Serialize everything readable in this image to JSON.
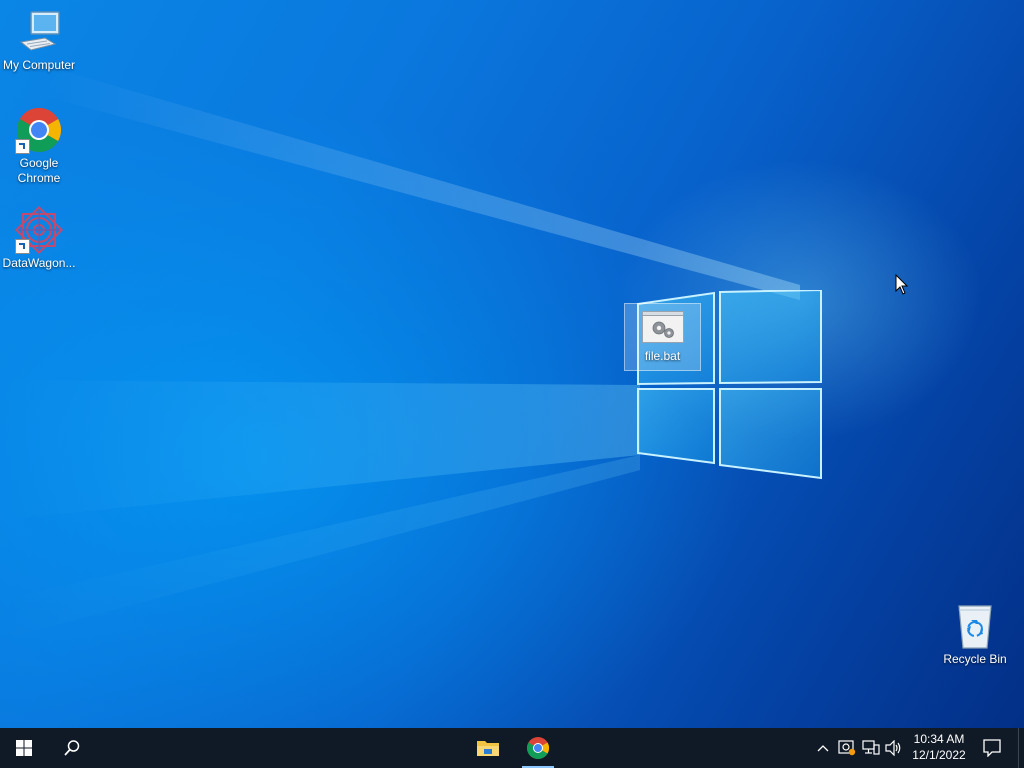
{
  "desktop": {
    "icons": [
      {
        "label": "My Computer",
        "icon": "computer-icon"
      },
      {
        "label": "Google Chrome",
        "icon": "chrome-icon",
        "shortcut": true
      },
      {
        "label": "DataWagon...",
        "icon": "datawagon-icon",
        "shortcut": true
      },
      {
        "label": "file.bat",
        "icon": "batch-file-icon",
        "selected": true
      },
      {
        "label": "Recycle Bin",
        "icon": "recycle-bin-icon"
      }
    ]
  },
  "taskbar": {
    "start_icon": "windows-start-icon",
    "search_icon": "search-icon",
    "pinned": [
      {
        "name": "File Explorer",
        "icon": "folder-icon"
      },
      {
        "name": "Google Chrome",
        "icon": "chrome-icon",
        "running": true
      }
    ],
    "tray": {
      "icons": [
        "chevron-up-icon",
        "windows-update-icon",
        "network-icon",
        "volume-icon"
      ],
      "time": "10:34 AM",
      "date": "12/1/2022",
      "notification_icon": "action-center-icon"
    }
  },
  "colors": {
    "taskbar_bg": "#101a26",
    "desktop_accent": "#0a78de"
  }
}
